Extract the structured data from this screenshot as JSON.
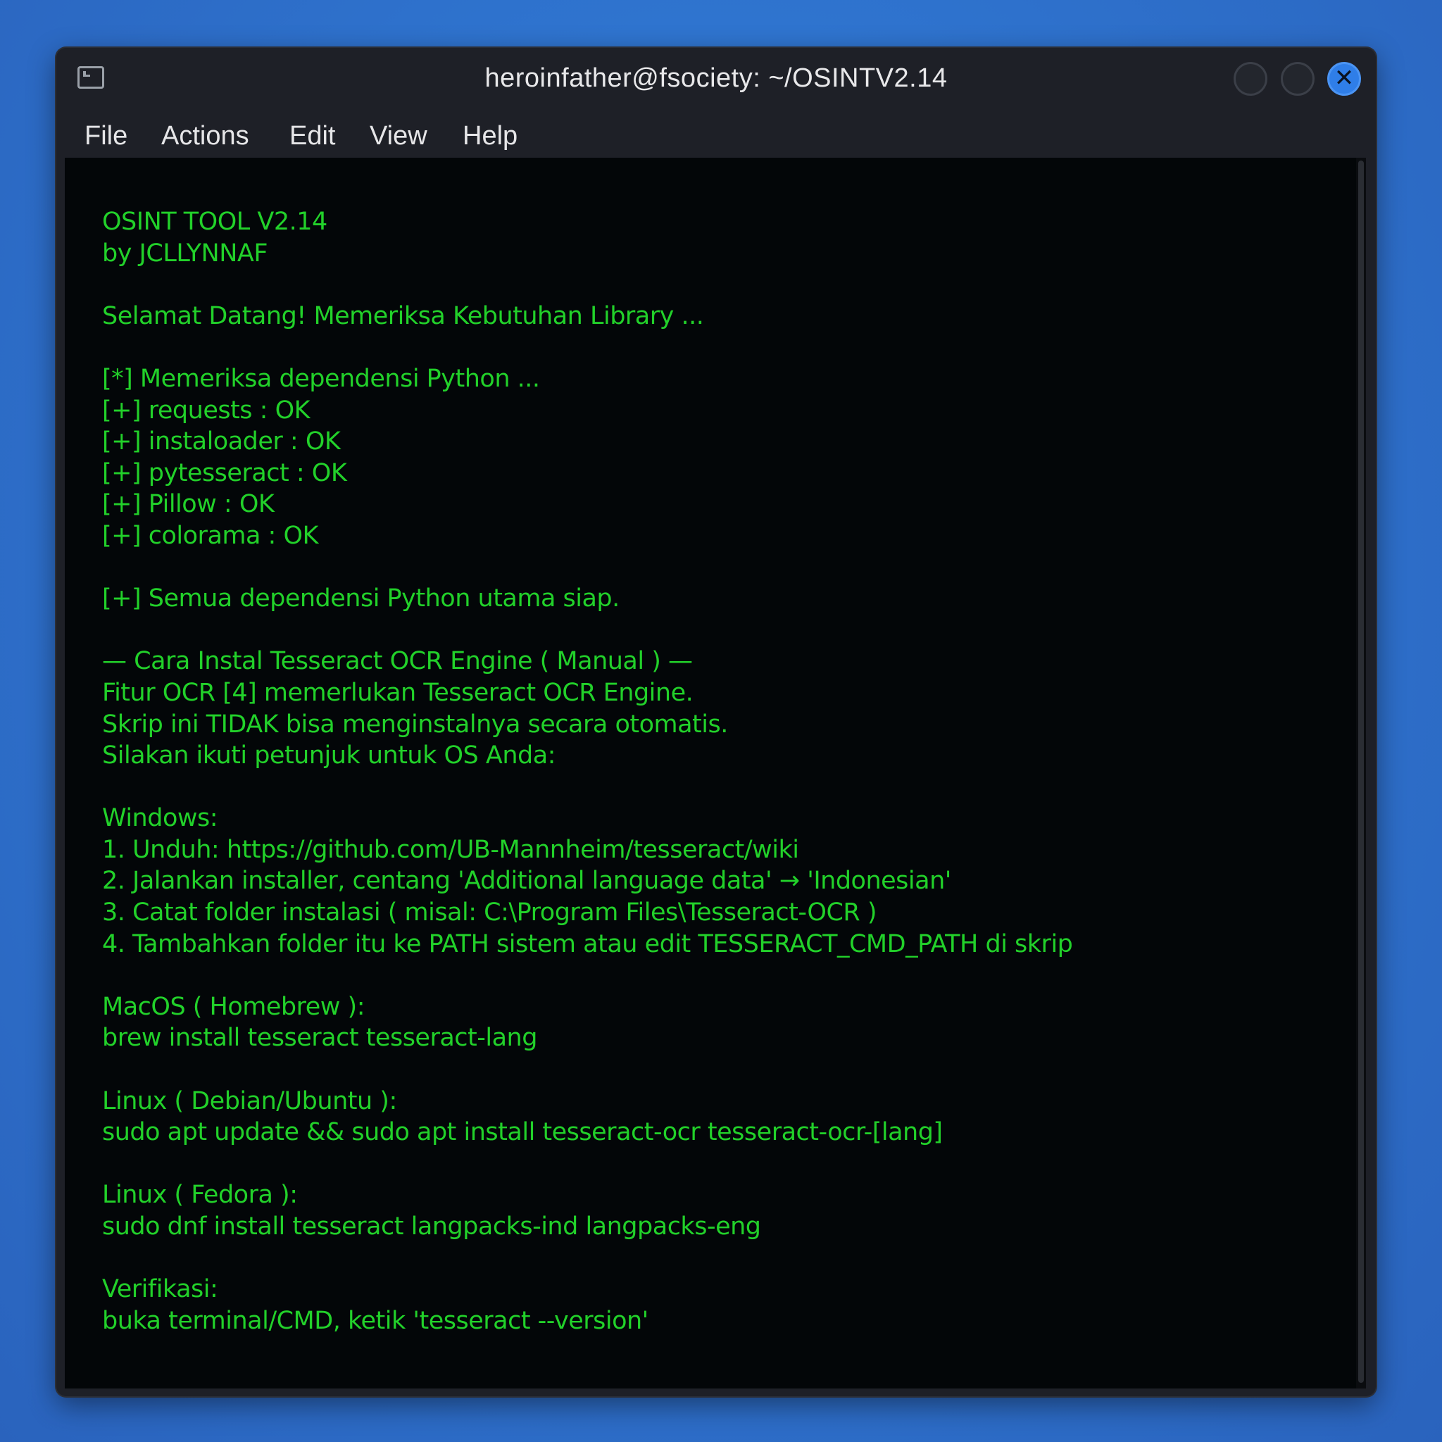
{
  "window": {
    "title": "heroinfather@fsociety: ~/OSINTV2.14",
    "icon": "terminal-icon",
    "controls": [
      "minimize-icon",
      "maximize-icon",
      "close-icon"
    ],
    "close_glyph": "✕"
  },
  "menu": {
    "items": [
      {
        "label": "File"
      },
      {
        "label": "Actions"
      },
      {
        "label": "Edit"
      },
      {
        "label": "View"
      },
      {
        "label": "Help"
      }
    ]
  },
  "terminal": {
    "text_color": "#22d12a",
    "background": "#030608",
    "lines": [
      "OSINT TOOL V2.14",
      "by JCLLYNNAF",
      "",
      "Selamat Datang! Memeriksa Kebutuhan Library ...",
      "",
      "[*] Memeriksa dependensi Python ...",
      "[+] requests : OK",
      "[+] instaloader : OK",
      "[+] pytesseract : OK",
      "[+] Pillow : OK",
      "[+] colorama : OK",
      "",
      "[+] Semua dependensi Python utama siap.",
      "",
      "— Cara Instal Tesseract OCR Engine ( Manual ) —",
      "Fitur OCR [4] memerlukan Tesseract OCR Engine.",
      "Skrip ini TIDAK bisa menginstalnya secara otomatis.",
      "Silakan ikuti petunjuk untuk OS Anda:",
      "",
      "Windows:",
      "1. Unduh: https://github.com/UB-Mannheim/tesseract/wiki",
      "2. Jalankan installer, centang 'Additional language data' → 'Indonesian'",
      "3. Catat folder instalasi ( misal: C:\\Program Files\\Tesseract-OCR )",
      "4. Tambahkan folder itu ke PATH sistem atau edit TESSERACT_CMD_PATH di skrip",
      "",
      "MacOS ( Homebrew ):",
      "brew install tesseract tesseract-lang",
      "",
      "Linux ( Debian/Ubuntu ):",
      "sudo apt update && sudo apt install tesseract-ocr tesseract-ocr-[lang]",
      "",
      "Linux ( Fedora ):",
      "sudo dnf install tesseract langpacks-ind langpacks-eng",
      "",
      "Verifikasi:",
      "buka terminal/CMD, ketik 'tesseract --version'"
    ]
  }
}
